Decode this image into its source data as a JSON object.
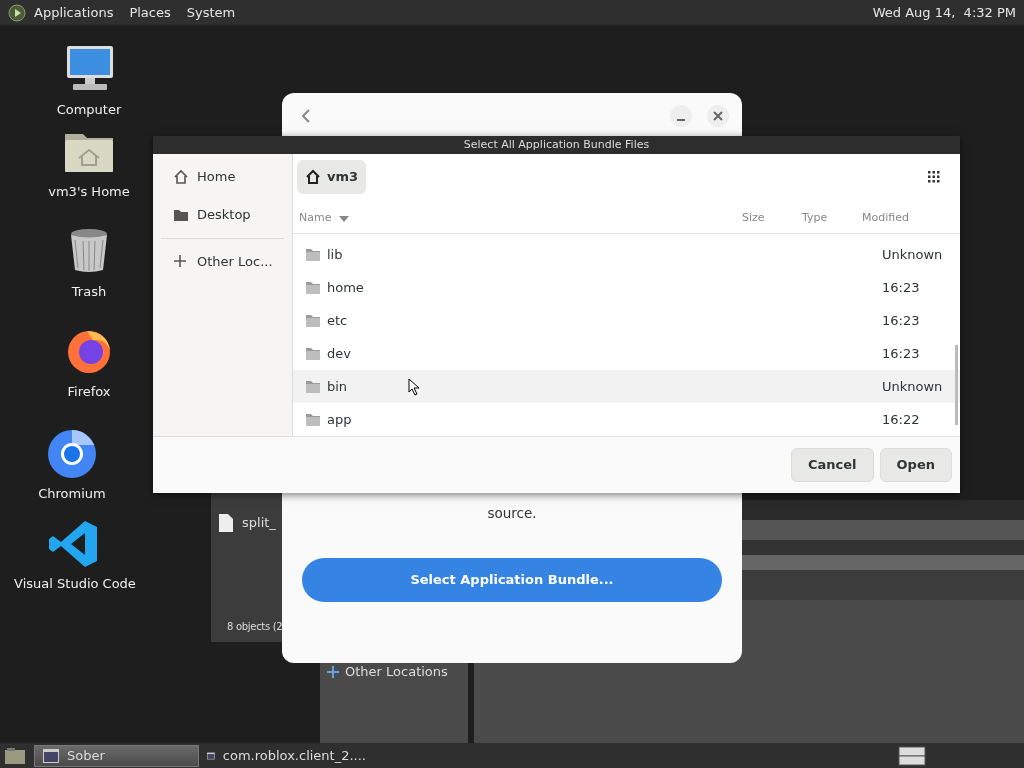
{
  "top_panel": {
    "menus": [
      "Applications",
      "Places",
      "System"
    ],
    "clock": "Wed Aug 14,  4:32 PM"
  },
  "desktop_icons": [
    {
      "label": "Computer",
      "kind": "computer"
    },
    {
      "label": "vm3's Home",
      "kind": "home"
    },
    {
      "label": "Trash",
      "kind": "trash"
    },
    {
      "label": "Firefox",
      "kind": "firefox"
    },
    {
      "label": "Chromium",
      "kind": "chromium"
    },
    {
      "label": "Visual Studio Code",
      "kind": "vscode"
    }
  ],
  "background_file_window": {
    "items": [
      "split_"
    ],
    "status": "8 objects (2"
  },
  "background_places_window": {
    "item": "Other Locations"
  },
  "sober_window": {
    "text": "source.",
    "button": "Select Application Bundle..."
  },
  "file_dialog": {
    "title": "Select All Application Bundle Files",
    "places": [
      {
        "label": "Home",
        "kind": "home"
      },
      {
        "label": "Desktop",
        "kind": "folder"
      },
      {
        "label": "Other Loc...",
        "kind": "plus"
      }
    ],
    "path_button": "vm3",
    "columns": [
      "Name",
      "Size",
      "Type",
      "Modified"
    ],
    "rows": [
      {
        "name": "lib",
        "modified": "Unknown",
        "hovered": false
      },
      {
        "name": "home",
        "modified": "16:23",
        "hovered": false
      },
      {
        "name": "etc",
        "modified": "16:23",
        "hovered": false
      },
      {
        "name": "dev",
        "modified": "16:23",
        "hovered": false
      },
      {
        "name": "bin",
        "modified": "Unknown",
        "hovered": true
      },
      {
        "name": "app",
        "modified": "16:22",
        "hovered": false
      }
    ],
    "buttons": [
      "Cancel",
      "Open"
    ]
  },
  "taskbar": {
    "tasks": [
      {
        "label": "Sober",
        "selected": true
      },
      {
        "label": "com.roblox.client_2....",
        "selected": false
      }
    ]
  }
}
